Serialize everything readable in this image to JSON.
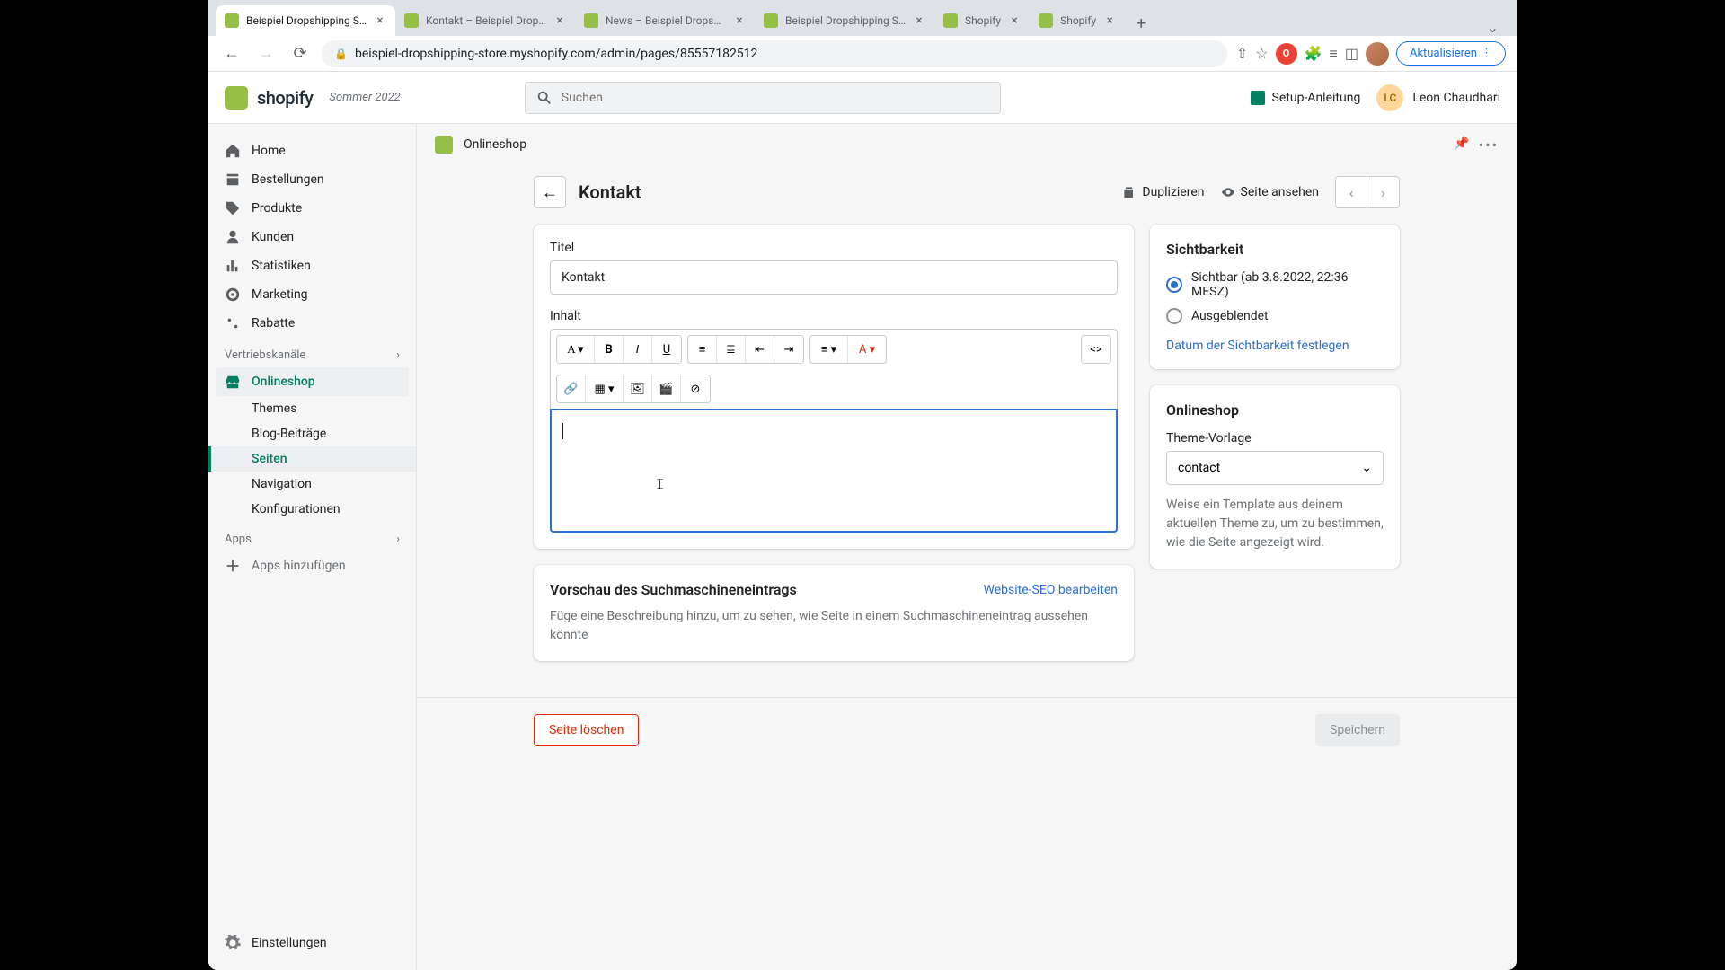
{
  "browser": {
    "tabs": [
      {
        "title": "Beispiel Dropshipping Stor"
      },
      {
        "title": "Kontakt – Beispiel Dropship"
      },
      {
        "title": "News – Beispiel Dropshipp"
      },
      {
        "title": "Beispiel Dropshipping Stor"
      },
      {
        "title": "Shopify"
      },
      {
        "title": "Shopify"
      }
    ],
    "url": "beispiel-dropshipping-store.myshopify.com/admin/pages/85557182512",
    "update_button": "Aktualisieren"
  },
  "topbar": {
    "logo": "shopify",
    "season": "Sommer 2022",
    "search_placeholder": "Suchen",
    "setup": "Setup-Anleitung",
    "user_initials": "LC",
    "user_name": "Leon Chaudhari"
  },
  "sidebar": {
    "home": "Home",
    "orders": "Bestellungen",
    "products": "Produkte",
    "customers": "Kunden",
    "analytics": "Statistiken",
    "marketing": "Marketing",
    "discounts": "Rabatte",
    "channels_label": "Vertriebskanäle",
    "onlineshop": "Onlineshop",
    "themes": "Themes",
    "blog": "Blog-Beiträge",
    "pages": "Seiten",
    "navigation": "Navigation",
    "config": "Konfigurationen",
    "apps_label": "Apps",
    "add_apps": "Apps hinzufügen",
    "settings": "Einstellungen"
  },
  "breadcrumb": {
    "text": "Onlineshop"
  },
  "page": {
    "title": "Kontakt",
    "duplicate": "Duplizieren",
    "view": "Seite ansehen"
  },
  "form": {
    "title_label": "Titel",
    "title_value": "Kontakt",
    "content_label": "Inhalt"
  },
  "seo": {
    "heading": "Vorschau des Suchmaschineneintrags",
    "edit": "Website-SEO bearbeiten",
    "description": "Füge eine Beschreibung hinzu, um zu sehen, wie Seite in einem Suchmaschineneintrag aussehen könnte"
  },
  "visibility": {
    "heading": "Sichtbarkeit",
    "visible": "Sichtbar (ab 3.8.2022, 22:36 MESZ)",
    "hidden": "Ausgeblendet",
    "schedule": "Datum der Sichtbarkeit festlegen"
  },
  "template": {
    "heading": "Onlineshop",
    "label": "Theme-Vorlage",
    "value": "contact",
    "help": "Weise ein Template aus deinem aktuellen Theme zu, um zu bestimmen, wie die Seite angezeigt wird."
  },
  "footer": {
    "delete": "Seite löschen",
    "save": "Speichern"
  }
}
